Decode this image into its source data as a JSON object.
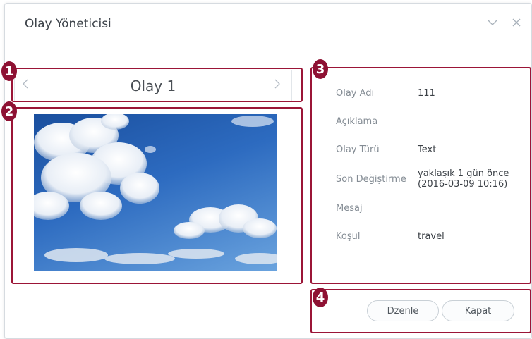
{
  "window": {
    "title": "Olay Yöneticisi",
    "minimize_icon": "chevron-down-icon",
    "close_icon": "close-icon"
  },
  "event_nav": {
    "title": "Olay 1",
    "prev_icon": "chevron-left-icon",
    "next_icon": "chevron-right-icon"
  },
  "callouts": [
    "1",
    "2",
    "3",
    "4"
  ],
  "details": {
    "name_label": "Olay Adı",
    "name_value": "111",
    "description_label": "Açıklama",
    "description_value": "",
    "type_label": "Olay Türü",
    "type_value": "Text",
    "modified_label": "Son Değiştirme",
    "modified_value_line1": "yaklaşık 1 gün önce",
    "modified_value_line2": "(2016-03-09 10:16)",
    "message_label": "Mesaj",
    "message_value": "",
    "condition_label": "Koşul",
    "condition_value": "travel"
  },
  "buttons": {
    "edit_label": "Dzenle",
    "close_label": "Kapat"
  },
  "colors": {
    "callout": "#9b1537",
    "badge": "#8e1133"
  }
}
